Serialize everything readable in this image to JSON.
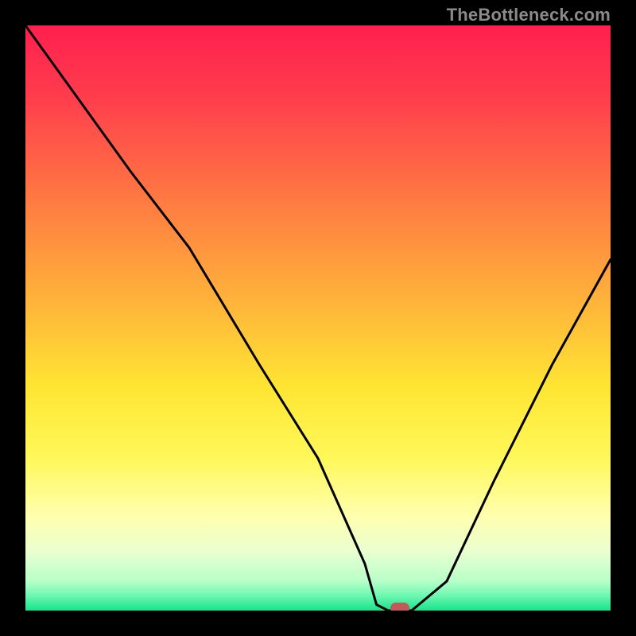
{
  "watermark": "TheBottleneck.com",
  "chart_data": {
    "type": "line",
    "title": "",
    "xlabel": "",
    "ylabel": "",
    "xlim": [
      0,
      100
    ],
    "ylim": [
      0,
      100
    ],
    "series": [
      {
        "name": "bottleneck-curve",
        "x": [
          0,
          18,
          28,
          40,
          50,
          58,
          60,
          62,
          66,
          72,
          80,
          90,
          100
        ],
        "values": [
          100,
          75,
          62,
          42,
          26,
          8,
          1,
          0,
          0,
          5,
          22,
          42,
          60
        ]
      }
    ],
    "marker": {
      "x": 64,
      "y": 0,
      "color": "#c15a5a"
    },
    "background_gradient": {
      "stops": [
        {
          "offset": 0,
          "color": "#ff1f4f"
        },
        {
          "offset": 0.12,
          "color": "#ff3c4c"
        },
        {
          "offset": 0.3,
          "color": "#ff7a42"
        },
        {
          "offset": 0.48,
          "color": "#ffb63a"
        },
        {
          "offset": 0.62,
          "color": "#ffe633"
        },
        {
          "offset": 0.74,
          "color": "#fff85a"
        },
        {
          "offset": 0.84,
          "color": "#ffffb0"
        },
        {
          "offset": 0.9,
          "color": "#e9ffd0"
        },
        {
          "offset": 0.95,
          "color": "#b7ffc9"
        },
        {
          "offset": 0.975,
          "color": "#6cf7b0"
        },
        {
          "offset": 1.0,
          "color": "#17e28a"
        }
      ]
    }
  }
}
